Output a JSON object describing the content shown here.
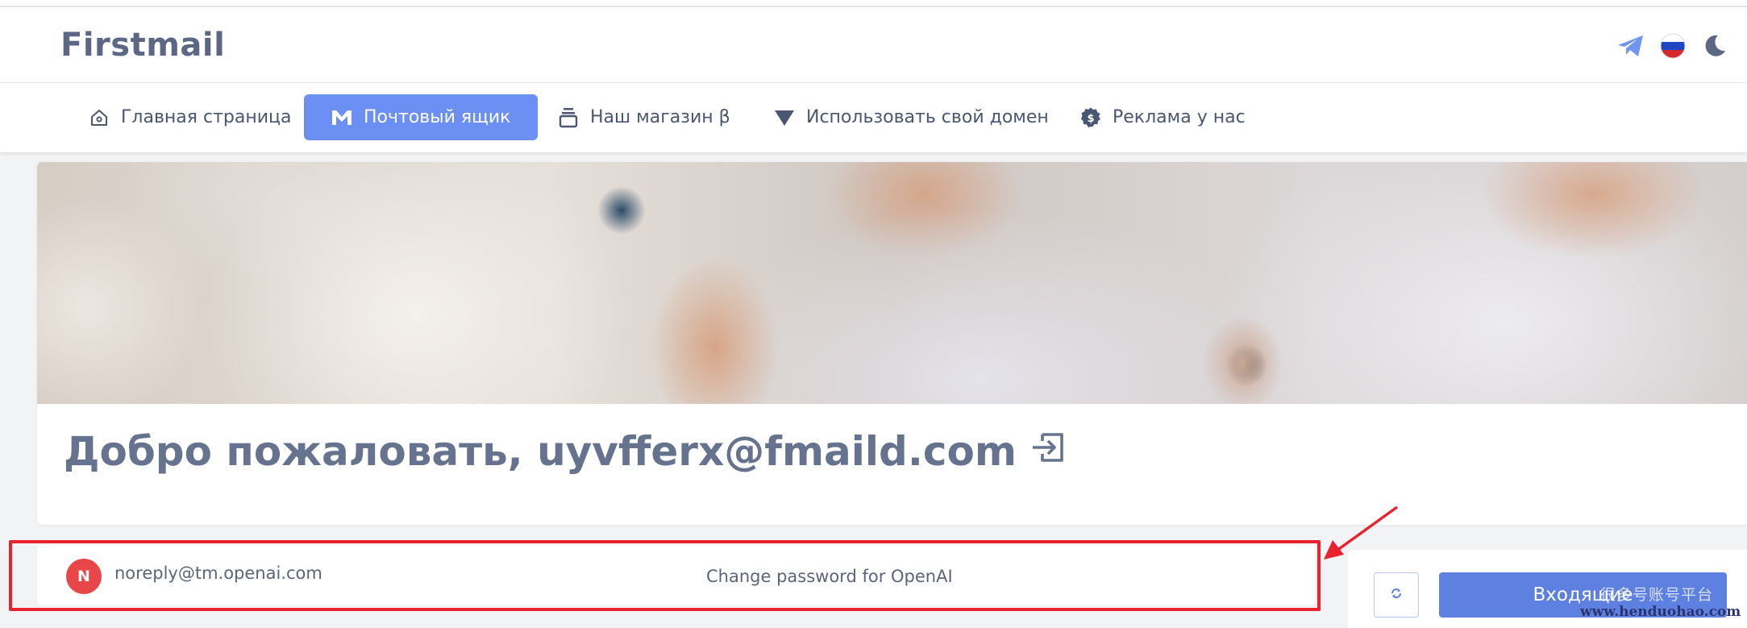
{
  "header": {
    "logo": "Firstmail",
    "icons": [
      "telegram-icon",
      "russia-flag-icon",
      "moon-icon"
    ]
  },
  "nav": {
    "items": [
      {
        "label": "Главная страница",
        "icon": "home-icon",
        "active": false
      },
      {
        "label": "Почтовый ящик",
        "icon": "gmail-m-icon",
        "active": true
      },
      {
        "label": "Наш магазин β",
        "icon": "stack-icon",
        "active": false
      },
      {
        "label": "Использовать свой домен",
        "icon": "triangle-down-icon",
        "active": false
      },
      {
        "label": "Реклама у нас",
        "icon": "dollar-gear-icon",
        "active": false
      }
    ]
  },
  "welcome": {
    "text": "Добро пожаловать, uyvfferx@fmaild.com",
    "icon": "logout-icon"
  },
  "mail": {
    "avatar_letter": "N",
    "sender": "noreply@tm.openai.com",
    "subject": "Change password for OpenAI"
  },
  "side_panel": {
    "refresh_icon": "refresh-icon",
    "inbox_label": "Входящие"
  },
  "watermark": {
    "line1": "很多号账号平台",
    "line2": "www.henduohao.com"
  },
  "colors": {
    "accent": "#6b8ff2",
    "inbox_button": "#5e80e0",
    "avatar": "#e8474a",
    "highlight": "#e8232d",
    "text": "#5a6680"
  }
}
